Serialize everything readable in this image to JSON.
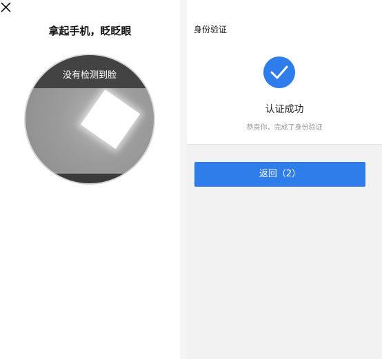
{
  "face_capture": {
    "title": "拿起手机，眨眨眼",
    "banner_text": "没有检测到脸",
    "close_icon": "close-icon"
  },
  "verification": {
    "header_title": "身份验证",
    "status_icon": "check-circle-icon",
    "status_title": "认证成功",
    "status_subtitle": "恭喜你，完成了身份验证",
    "back_button_label": "返回（2）"
  },
  "colors": {
    "accent_blue": "#2f7dea",
    "success_blue": "#2f7dea",
    "panel_gray": "#f2f2f2"
  }
}
